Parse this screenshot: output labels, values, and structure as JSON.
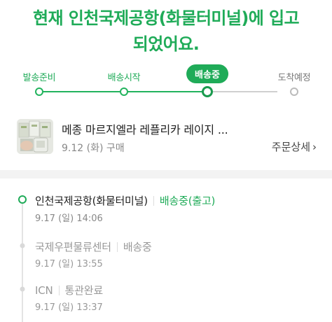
{
  "headline": {
    "line1": "현재 인천국제공항(화물터미널)에 입고",
    "line2": "되었어요."
  },
  "progress": {
    "steps": [
      {
        "label": "발송준비",
        "state": "done"
      },
      {
        "label": "배송시작",
        "state": "done"
      },
      {
        "label": "배송중",
        "state": "current"
      },
      {
        "label": "도착예정",
        "state": "future"
      }
    ]
  },
  "product": {
    "name": "메종 마르지엘라 레플리카 레이지 ...",
    "order_date": "9.12 (화) 구매",
    "detail_link": "주문상세",
    "detail_chevron": "›"
  },
  "timeline": [
    {
      "place": "인천국제공항(화물터미널)",
      "status": "배송중(출고)",
      "time": "9.17 (일) 14:06",
      "state": "current"
    },
    {
      "place": "국제우편물류센터",
      "status": "배송중",
      "time": "9.17 (일) 13:55",
      "state": "past"
    },
    {
      "place": "ICN",
      "status": "통관완료",
      "time": "9.17 (일) 13:37",
      "state": "past"
    }
  ],
  "colors": {
    "accent": "#1fab58",
    "muted": "#999999"
  }
}
